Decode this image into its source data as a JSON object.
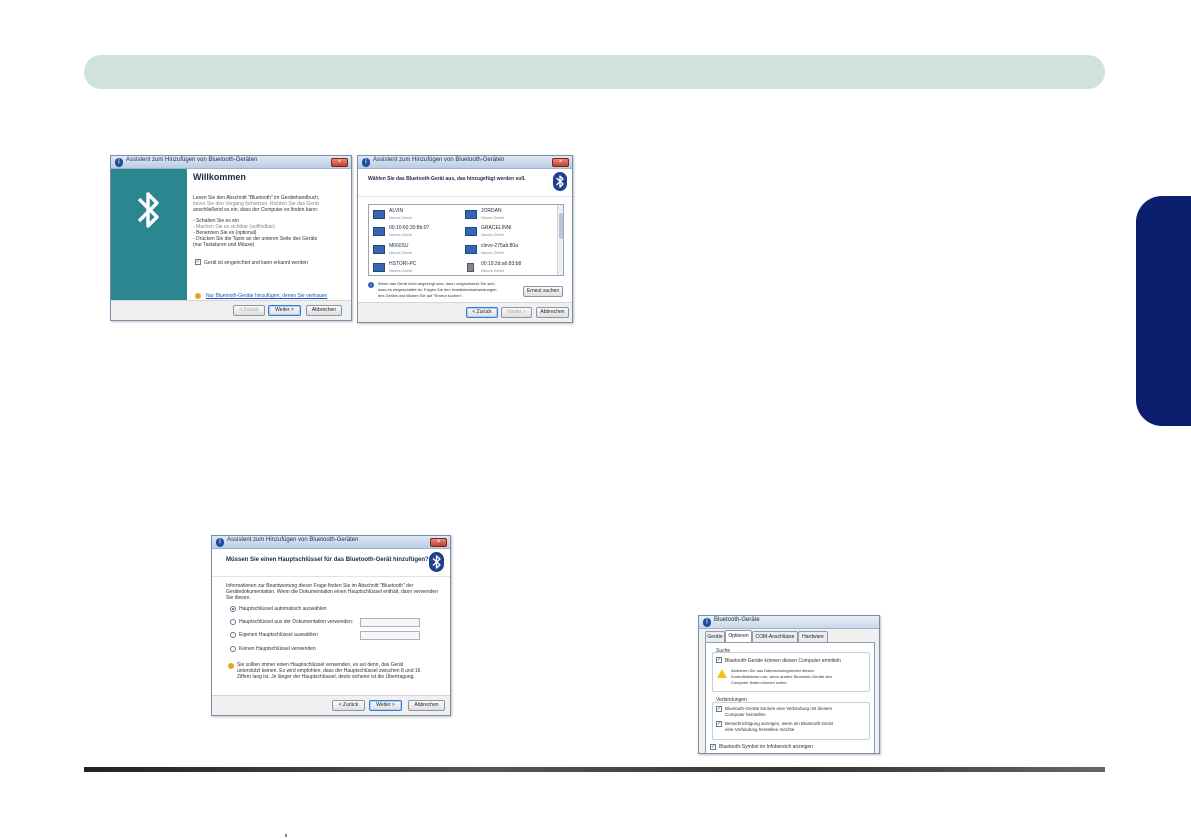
{
  "side_tab_color": "#0c1f6e",
  "header_bar_color": "#cfe3dc",
  "dialog1": {
    "title": "Assistent zum Hinzufügen von Bluetooth-Geräten",
    "heading": "Willkommen",
    "intro_line1": "Lesen Sie den Abschnitt \"Bluetooth\" im Gerätehandbuch,",
    "intro_line2": "bevor Sie den Vorgang fortsetzen. Richten Sie das Gerät",
    "intro_line3": "anschließend so ein, dass der Computer es finden kann:",
    "steps": [
      "- Schalten Sie es ein",
      "- Machen Sie es sichtbar (auffindbar)",
      "- Benennen Sie es (optional)",
      "- Drücken Sie die Taste an der unteren Seite des Geräts",
      "  (nur Tastaturen und Mäuse)"
    ],
    "checkbox_label": "Gerät ist eingerichtet und kann erkannt werden",
    "link": "Nur Bluetooth-Geräte hinzufügen, denen Sie vertrauen",
    "back_button": "< Zurück",
    "next_button": "Weiter >",
    "cancel_button": "Abbrechen",
    "close_icon": "close-icon",
    "logo_icon": "bluetooth-icon"
  },
  "dialog2": {
    "title": "Assistent zum Hinzufügen von Bluetooth-Geräten",
    "heading": "Wählen Sie das Bluetooth-Gerät aus, das hinzugefügt werden soll.",
    "devices": [
      {
        "name": "ALVIN",
        "status": "Neues Gerät"
      },
      {
        "name": "JORDAN",
        "status": "Neues Gerät"
      },
      {
        "name": "00:10:60:30:8b:07",
        "status": "Neues Gerät"
      },
      {
        "name": "GRACELINNI",
        "status": "Neues Gerät"
      },
      {
        "name": "M660SU",
        "status": "Neues Gerät"
      },
      {
        "name": "clevo-275ab:80a",
        "status": "Neues Gerät"
      },
      {
        "name": "HSTORI-PC",
        "status": "Neues Gerät"
      },
      {
        "name": "00:19:2d:a6:83:b8",
        "status": "Neues Gerät"
      }
    ],
    "info_line1": "Wenn das Gerät nicht angezeigt wird, dann vergewissern Sie sich,",
    "info_line2": "dass es eingeschaltet ist. Folgen Sie den Installationsanweisungen",
    "info_line3": "des Geräts und klicken Sie auf \"Erneut suchen\".",
    "search_again_button": "Erneut suchen",
    "back_button": "< Zurück",
    "next_button": "Weiter >",
    "cancel_button": "Abbrechen"
  },
  "dialog3": {
    "title": "Assistent zum Hinzufügen von Bluetooth-Geräten",
    "heading": "Müssen Sie einen Hauptschlüssel für das Bluetooth-Gerät hinzufügen?",
    "intro_line1": "Informationen zur Beantwortung dieser Frage finden Sie im Abschnitt \"Bluetooth\" der",
    "intro_line2": "Gerätedokumentation. Wenn die Dokumentation einen Hauptschlüssel enthält, dann verwenden",
    "intro_line3": "Sie diesen.",
    "options": [
      "Hauptschlüssel automatisch auswählen",
      "Hauptschlüssel aus der Dokumentation verwenden:",
      "Eigenen Hauptschlüssel auswählen",
      "Keinen Hauptschlüssel verwenden"
    ],
    "note_line1": "Sie sollten immer einen Hauptschlüssel verwenden, es sei denn, das Gerät",
    "note_line2": "unterstützt keinen. Es wird empfohlen, dass der Hauptschlüssel zwischen 8 und 16",
    "note_line3": "Ziffern lang ist. Je länger der Hauptschlüssel, desto sicherer ist die Übertragung.",
    "back_button": "< Zurück",
    "next_button": "Weiter >",
    "cancel_button": "Abbrechen"
  },
  "dialog4": {
    "title": "Bluetooth-Geräte",
    "tabs": [
      "Geräte",
      "Optionen",
      "COM-Anschlüsse",
      "Hardware"
    ],
    "search_group": "Suche",
    "search_check": "Bluetooth-Geräte können diesen Computer ermitteln",
    "warning_line1": "Aktivieren Sie aus Datenschutzgründen dieses",
    "warning_line2": "Kontrollkästchen nur, wenn andere Bluetooth-Geräte den",
    "warning_line3": "Computer finden können sollen.",
    "connections_group": "Verbindungen",
    "conn_check1_line1": "Bluetooth-Geräte können eine Verbindung mit diesem",
    "conn_check1_line2": "Computer herstellen",
    "conn_check2_line1": "Benachrichtigung anzeigen, wenn ein Bluetooth-Gerät",
    "conn_check2_line2": "eine Verbindung herstellen möchte",
    "tray_check": "Bluetooth-Symbol im Infobereich anzeigen"
  }
}
